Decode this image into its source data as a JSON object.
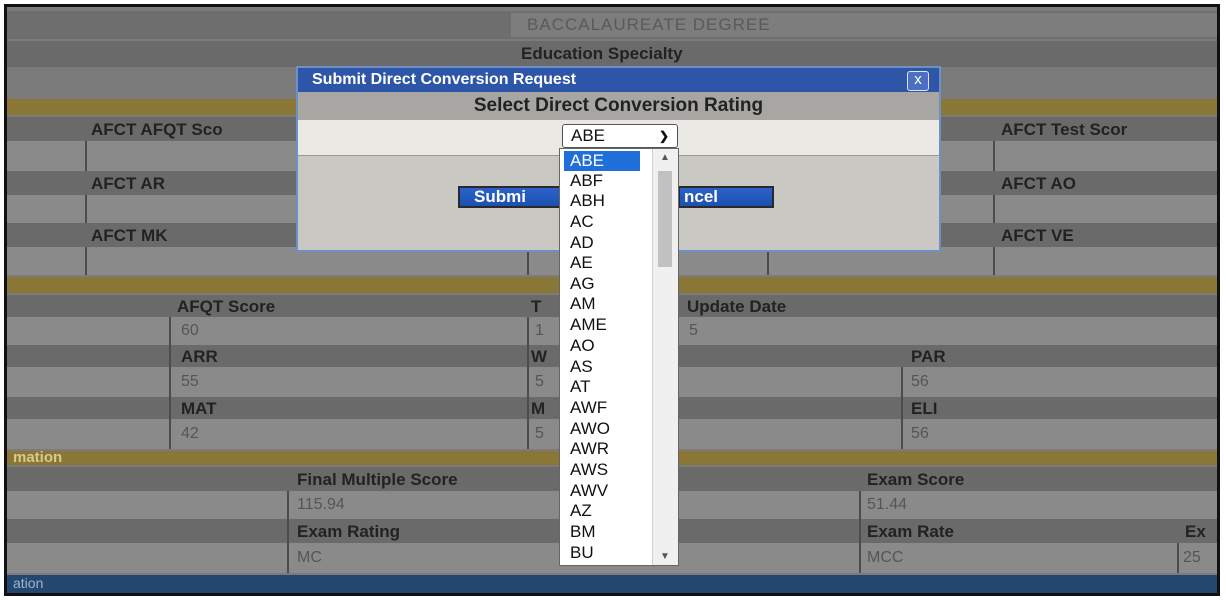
{
  "degree": "BACCALAUREATE DEGREE",
  "education_specialty": "Education Specialty",
  "afct": {
    "afqt_score_label": "AFCT AFQT Sco",
    "test_score_label": "AFCT Test Scor",
    "ar_label": "AFCT AR",
    "ao_label": "AFCT AO",
    "mk_label": "AFCT MK",
    "ve_label": "AFCT VE"
  },
  "scores": {
    "afqt_label": "AFQT Score",
    "afqt_value": "60",
    "update_label_partial": "Update Date",
    "t_partial": "T",
    "date_partial_left": "1",
    "date_partial_right": "5",
    "arr_label": "ARR",
    "arr_value": "55",
    "w_partial": "W",
    "w_value_partial": "5",
    "par_label": "PAR",
    "par_value": "56",
    "mat_label": "MAT",
    "mat_value": "42",
    "m_partial": "M",
    "m_value_partial": "5",
    "eli_label": "ELI",
    "eli_value": "56"
  },
  "section_label": "mation",
  "exam": {
    "fms_label": "Final Multiple Score",
    "fms_value": "115.94",
    "exam_score_label": "Exam Score",
    "exam_score_value": "51.44",
    "exam_rating_label": "Exam Rating",
    "exam_rating_value": "MC",
    "exam_rate_label": "Exam Rate",
    "exam_rate_value": "MCC",
    "edge_label": "Ex",
    "edge_value": "25"
  },
  "footer_label": "ation",
  "dialog": {
    "title": "Submit Direct Conversion Request",
    "close": "x",
    "subtitle": "Select Direct Conversion Rating",
    "submit_label": "Submi",
    "cancel_label": "ncel"
  },
  "select": {
    "selected": "ABE",
    "options": [
      "ABE",
      "ABF",
      "ABH",
      "AC",
      "AD",
      "AE",
      "AG",
      "AM",
      "AME",
      "AO",
      "AS",
      "AT",
      "AWF",
      "AWO",
      "AWR",
      "AWS",
      "AWV",
      "AZ",
      "BM",
      "BU"
    ]
  },
  "colors": {
    "accent": "#2d56a8",
    "gold": "#8a7635",
    "selected": "#1e6fd9"
  }
}
